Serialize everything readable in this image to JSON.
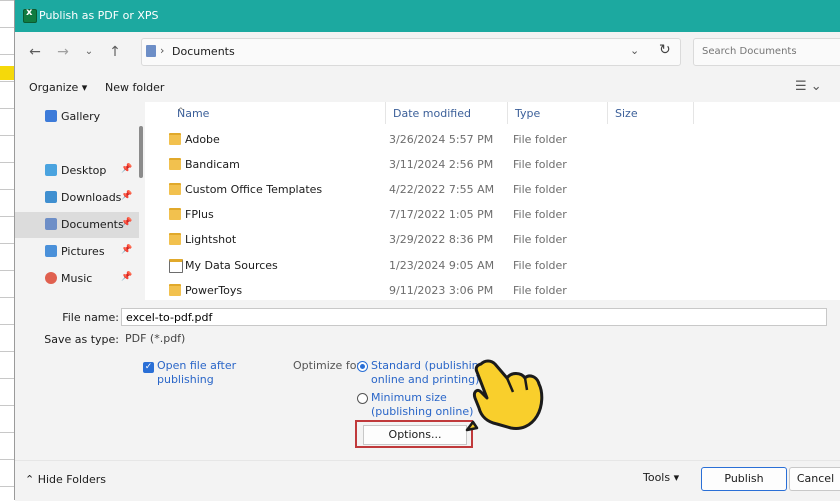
{
  "window": {
    "title": "Publish as PDF or XPS"
  },
  "nav": {
    "back_icon": "arrow-left-icon",
    "forward_icon": "arrow-right-icon",
    "recent_icon": "chevron-down-icon",
    "up_icon": "arrow-up-icon",
    "breadcrumb": "Documents",
    "search_placeholder": "Search Documents"
  },
  "toolbar": {
    "organize": "Organize ▾",
    "new_folder": "New folder"
  },
  "sidebar": {
    "items": [
      {
        "label": "Gallery",
        "icon": "gallery-icon",
        "color": "#3d7bd9"
      },
      {
        "label": "Desktop",
        "icon": "desktop-icon",
        "color": "#4aa3df"
      },
      {
        "label": "Downloads",
        "icon": "download-icon",
        "color": "#3f8fd0"
      },
      {
        "label": "Documents",
        "icon": "document-icon",
        "color": "#6d8ec7"
      },
      {
        "label": "Pictures",
        "icon": "pictures-icon",
        "color": "#4a90d9"
      },
      {
        "label": "Music",
        "icon": "music-icon",
        "color": "#e0604f"
      }
    ]
  },
  "columns": {
    "name": "Name",
    "date": "Date modified",
    "type": "Type",
    "size": "Size"
  },
  "files": [
    {
      "name": "Adobe",
      "date": "3/26/2024 5:57 PM",
      "type": "File folder"
    },
    {
      "name": "Bandicam",
      "date": "3/11/2024 2:56 PM",
      "type": "File folder"
    },
    {
      "name": "Custom Office Templates",
      "date": "4/22/2022 7:55 AM",
      "type": "File folder"
    },
    {
      "name": "FPlus",
      "date": "7/17/2022 1:05 PM",
      "type": "File folder"
    },
    {
      "name": "Lightshot",
      "date": "3/29/2022 8:36 PM",
      "type": "File folder"
    },
    {
      "name": "My Data Sources",
      "date": "1/23/2024 9:05 AM",
      "type": "File folder"
    },
    {
      "name": "PowerToys",
      "date": "9/11/2023 3:06 PM",
      "type": "File folder"
    }
  ],
  "form": {
    "file_name_label": "File name:",
    "file_name_value": "excel-to-pdf.pdf",
    "save_type_label": "Save as type:",
    "save_type_value": "PDF (*.pdf)",
    "open_after_line1": "Open file after",
    "open_after_line2": "publishing",
    "optimize_label": "Optimize for:",
    "standard_line1": "Standard (publishing",
    "standard_line2": "online and printing)",
    "minimum_line1": "Minimum size",
    "minimum_line2": "(publishing online)",
    "options_button": "Options..."
  },
  "footer": {
    "hide_folders": "Hide Folders",
    "tools": "Tools",
    "publish": "Publish",
    "cancel": "Cancel"
  },
  "colors": {
    "titlebar": "#1ca9a0",
    "accent": "#2a6fd6",
    "highlight": "#c0393b"
  }
}
